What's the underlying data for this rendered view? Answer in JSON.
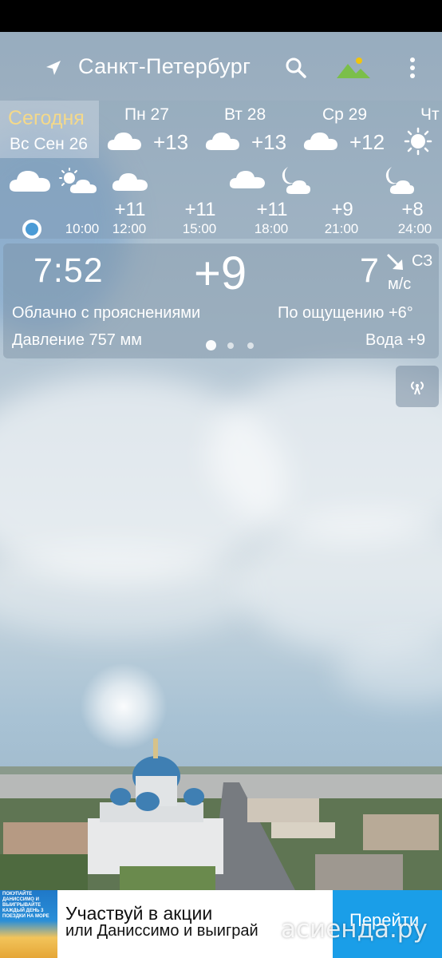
{
  "header": {
    "city": "Санкт-Петербург",
    "icons": {
      "location": "location-arrow-icon",
      "search": "search-icon",
      "landscape": "landscape-icon",
      "menu": "more-vert-icon"
    }
  },
  "today": {
    "label": "Сегодня",
    "date": "Вс Сен 26"
  },
  "days": [
    {
      "name": "Пн 27",
      "temp": "+13",
      "icon": "cloud-icon"
    },
    {
      "name": "Вт 28",
      "temp": "+13",
      "icon": "cloud-icon"
    },
    {
      "name": "Ср 29",
      "temp": "+12",
      "icon": "cloud-icon"
    },
    {
      "name": "Чт",
      "temp": "",
      "icon": "sun-icon"
    }
  ],
  "hourly": [
    {
      "time": "10:00",
      "temp": "",
      "icon": "cloud-sun-icon"
    },
    {
      "time": "12:00",
      "temp": "+11",
      "icon": "cloud-icon"
    },
    {
      "time": "15:00",
      "temp": "+11",
      "icon": "cloud-icon"
    },
    {
      "time": "18:00",
      "temp": "+11",
      "icon": "cloud-icon"
    },
    {
      "time": "21:00",
      "temp": "+9",
      "icon": "moon-cloud-icon"
    },
    {
      "time": "24:00",
      "temp": "+8",
      "icon": "moon-cloud-icon"
    }
  ],
  "current": {
    "time": "7:52",
    "temp": "+9",
    "wind_speed": "7",
    "wind_dir": "СЗ",
    "wind_unit": "м/с",
    "condition": "Облачно с прояснениями",
    "feels_like": "По ощущению +6°",
    "pressure": "Давление 757 мм",
    "water": "Вода +9",
    "pager": {
      "pages": 3,
      "active": 1
    }
  },
  "ad": {
    "image_text": "ПОКУПАЙТЕ ДАНИССИМО И ВЫИГРЫВАЙТЕ КАЖДЫЙ ДЕНЬ 3 ПОЕЗДКИ НА МОРЕ",
    "line1": "Участвуй в акции",
    "line2": "или Даниссимо и выиграй",
    "button": "Перейти"
  },
  "watermark": "асиенда.ру"
}
